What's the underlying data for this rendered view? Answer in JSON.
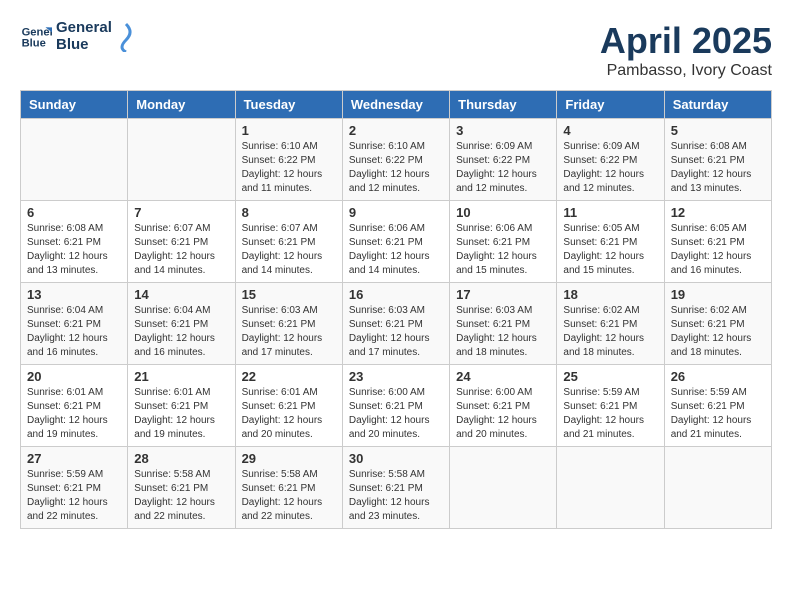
{
  "header": {
    "logo_line1": "General",
    "logo_line2": "Blue",
    "title": "April 2025",
    "subtitle": "Pambasso, Ivory Coast"
  },
  "days_of_week": [
    "Sunday",
    "Monday",
    "Tuesday",
    "Wednesday",
    "Thursday",
    "Friday",
    "Saturday"
  ],
  "weeks": [
    [
      {
        "num": "",
        "sunrise": "",
        "sunset": "",
        "daylight": ""
      },
      {
        "num": "",
        "sunrise": "",
        "sunset": "",
        "daylight": ""
      },
      {
        "num": "1",
        "sunrise": "Sunrise: 6:10 AM",
        "sunset": "Sunset: 6:22 PM",
        "daylight": "Daylight: 12 hours and 11 minutes."
      },
      {
        "num": "2",
        "sunrise": "Sunrise: 6:10 AM",
        "sunset": "Sunset: 6:22 PM",
        "daylight": "Daylight: 12 hours and 12 minutes."
      },
      {
        "num": "3",
        "sunrise": "Sunrise: 6:09 AM",
        "sunset": "Sunset: 6:22 PM",
        "daylight": "Daylight: 12 hours and 12 minutes."
      },
      {
        "num": "4",
        "sunrise": "Sunrise: 6:09 AM",
        "sunset": "Sunset: 6:22 PM",
        "daylight": "Daylight: 12 hours and 12 minutes."
      },
      {
        "num": "5",
        "sunrise": "Sunrise: 6:08 AM",
        "sunset": "Sunset: 6:21 PM",
        "daylight": "Daylight: 12 hours and 13 minutes."
      }
    ],
    [
      {
        "num": "6",
        "sunrise": "Sunrise: 6:08 AM",
        "sunset": "Sunset: 6:21 PM",
        "daylight": "Daylight: 12 hours and 13 minutes."
      },
      {
        "num": "7",
        "sunrise": "Sunrise: 6:07 AM",
        "sunset": "Sunset: 6:21 PM",
        "daylight": "Daylight: 12 hours and 14 minutes."
      },
      {
        "num": "8",
        "sunrise": "Sunrise: 6:07 AM",
        "sunset": "Sunset: 6:21 PM",
        "daylight": "Daylight: 12 hours and 14 minutes."
      },
      {
        "num": "9",
        "sunrise": "Sunrise: 6:06 AM",
        "sunset": "Sunset: 6:21 PM",
        "daylight": "Daylight: 12 hours and 14 minutes."
      },
      {
        "num": "10",
        "sunrise": "Sunrise: 6:06 AM",
        "sunset": "Sunset: 6:21 PM",
        "daylight": "Daylight: 12 hours and 15 minutes."
      },
      {
        "num": "11",
        "sunrise": "Sunrise: 6:05 AM",
        "sunset": "Sunset: 6:21 PM",
        "daylight": "Daylight: 12 hours and 15 minutes."
      },
      {
        "num": "12",
        "sunrise": "Sunrise: 6:05 AM",
        "sunset": "Sunset: 6:21 PM",
        "daylight": "Daylight: 12 hours and 16 minutes."
      }
    ],
    [
      {
        "num": "13",
        "sunrise": "Sunrise: 6:04 AM",
        "sunset": "Sunset: 6:21 PM",
        "daylight": "Daylight: 12 hours and 16 minutes."
      },
      {
        "num": "14",
        "sunrise": "Sunrise: 6:04 AM",
        "sunset": "Sunset: 6:21 PM",
        "daylight": "Daylight: 12 hours and 16 minutes."
      },
      {
        "num": "15",
        "sunrise": "Sunrise: 6:03 AM",
        "sunset": "Sunset: 6:21 PM",
        "daylight": "Daylight: 12 hours and 17 minutes."
      },
      {
        "num": "16",
        "sunrise": "Sunrise: 6:03 AM",
        "sunset": "Sunset: 6:21 PM",
        "daylight": "Daylight: 12 hours and 17 minutes."
      },
      {
        "num": "17",
        "sunrise": "Sunrise: 6:03 AM",
        "sunset": "Sunset: 6:21 PM",
        "daylight": "Daylight: 12 hours and 18 minutes."
      },
      {
        "num": "18",
        "sunrise": "Sunrise: 6:02 AM",
        "sunset": "Sunset: 6:21 PM",
        "daylight": "Daylight: 12 hours and 18 minutes."
      },
      {
        "num": "19",
        "sunrise": "Sunrise: 6:02 AM",
        "sunset": "Sunset: 6:21 PM",
        "daylight": "Daylight: 12 hours and 18 minutes."
      }
    ],
    [
      {
        "num": "20",
        "sunrise": "Sunrise: 6:01 AM",
        "sunset": "Sunset: 6:21 PM",
        "daylight": "Daylight: 12 hours and 19 minutes."
      },
      {
        "num": "21",
        "sunrise": "Sunrise: 6:01 AM",
        "sunset": "Sunset: 6:21 PM",
        "daylight": "Daylight: 12 hours and 19 minutes."
      },
      {
        "num": "22",
        "sunrise": "Sunrise: 6:01 AM",
        "sunset": "Sunset: 6:21 PM",
        "daylight": "Daylight: 12 hours and 20 minutes."
      },
      {
        "num": "23",
        "sunrise": "Sunrise: 6:00 AM",
        "sunset": "Sunset: 6:21 PM",
        "daylight": "Daylight: 12 hours and 20 minutes."
      },
      {
        "num": "24",
        "sunrise": "Sunrise: 6:00 AM",
        "sunset": "Sunset: 6:21 PM",
        "daylight": "Daylight: 12 hours and 20 minutes."
      },
      {
        "num": "25",
        "sunrise": "Sunrise: 5:59 AM",
        "sunset": "Sunset: 6:21 PM",
        "daylight": "Daylight: 12 hours and 21 minutes."
      },
      {
        "num": "26",
        "sunrise": "Sunrise: 5:59 AM",
        "sunset": "Sunset: 6:21 PM",
        "daylight": "Daylight: 12 hours and 21 minutes."
      }
    ],
    [
      {
        "num": "27",
        "sunrise": "Sunrise: 5:59 AM",
        "sunset": "Sunset: 6:21 PM",
        "daylight": "Daylight: 12 hours and 22 minutes."
      },
      {
        "num": "28",
        "sunrise": "Sunrise: 5:58 AM",
        "sunset": "Sunset: 6:21 PM",
        "daylight": "Daylight: 12 hours and 22 minutes."
      },
      {
        "num": "29",
        "sunrise": "Sunrise: 5:58 AM",
        "sunset": "Sunset: 6:21 PM",
        "daylight": "Daylight: 12 hours and 22 minutes."
      },
      {
        "num": "30",
        "sunrise": "Sunrise: 5:58 AM",
        "sunset": "Sunset: 6:21 PM",
        "daylight": "Daylight: 12 hours and 23 minutes."
      },
      {
        "num": "",
        "sunrise": "",
        "sunset": "",
        "daylight": ""
      },
      {
        "num": "",
        "sunrise": "",
        "sunset": "",
        "daylight": ""
      },
      {
        "num": "",
        "sunrise": "",
        "sunset": "",
        "daylight": ""
      }
    ]
  ]
}
